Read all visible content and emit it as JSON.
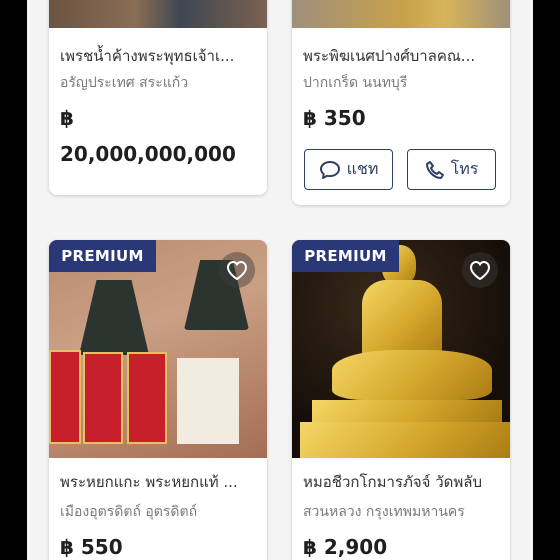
{
  "currency": "฿",
  "cards": [
    {
      "title": "เพรชน้ำค้างพระพุทธเจ้าเ...",
      "location": "อรัญประเทศ สระแก้ว",
      "price_symbol": "฿",
      "price": "20,000,000,000"
    },
    {
      "title": "พระพิฆเนศปางศ์บาลคณ...",
      "location": "ปากเกร็ด นนทบุรี",
      "price": "฿ 350",
      "chat_label": "แชท",
      "call_label": "โทร"
    },
    {
      "badge": "PREMIUM",
      "title": "พระหยกแกะ พระหยกแท้ ...",
      "location": "เมืองอุตรดิตถ์ อุตรดิตถ์",
      "price": "฿ 550"
    },
    {
      "badge": "PREMIUM",
      "title": "หมอชีวกโกมารภัจจ์ วัดพลับ",
      "location": "สวนหลวง กรุงเทพมหานคร",
      "price": "฿ 2,900"
    }
  ],
  "icons": {
    "chat": "chat-bubble-icon",
    "call": "phone-icon",
    "favorite": "heart-icon"
  },
  "colors": {
    "primary": "#2a3878",
    "button_border": "#2f3f66"
  }
}
